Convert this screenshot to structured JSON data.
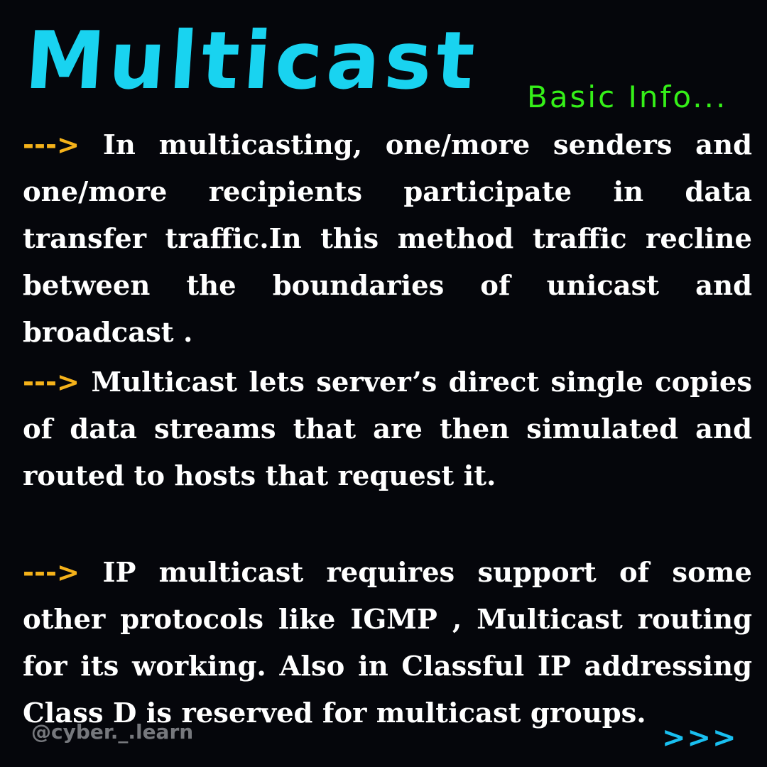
{
  "header": {
    "title": "Multicast",
    "subtitle": "Basic Info..."
  },
  "content": {
    "arrow": "--->",
    "paragraphs": [
      "In multicasting, one/more senders and one/more recipients participate in data transfer traffic.In this method traffic recline between the boundaries of unicast  and broadcast .",
      "Multicast lets server’s direct single copies of data streams that are then simulated and routed to hosts that request it.",
      "IP multicast requires support of some other protocols like IGMP , Multicast routing for its working. Also in Classful IP addressing Class D is reserved for multicast groups."
    ]
  },
  "footer": {
    "handle": "@cyber._.learn",
    "next": ">>>"
  },
  "colors": {
    "background": "#05060b",
    "title": "#19d3f0",
    "subtitle": "#35f018",
    "arrow": "#f5b21a",
    "next": "#19bff0"
  }
}
